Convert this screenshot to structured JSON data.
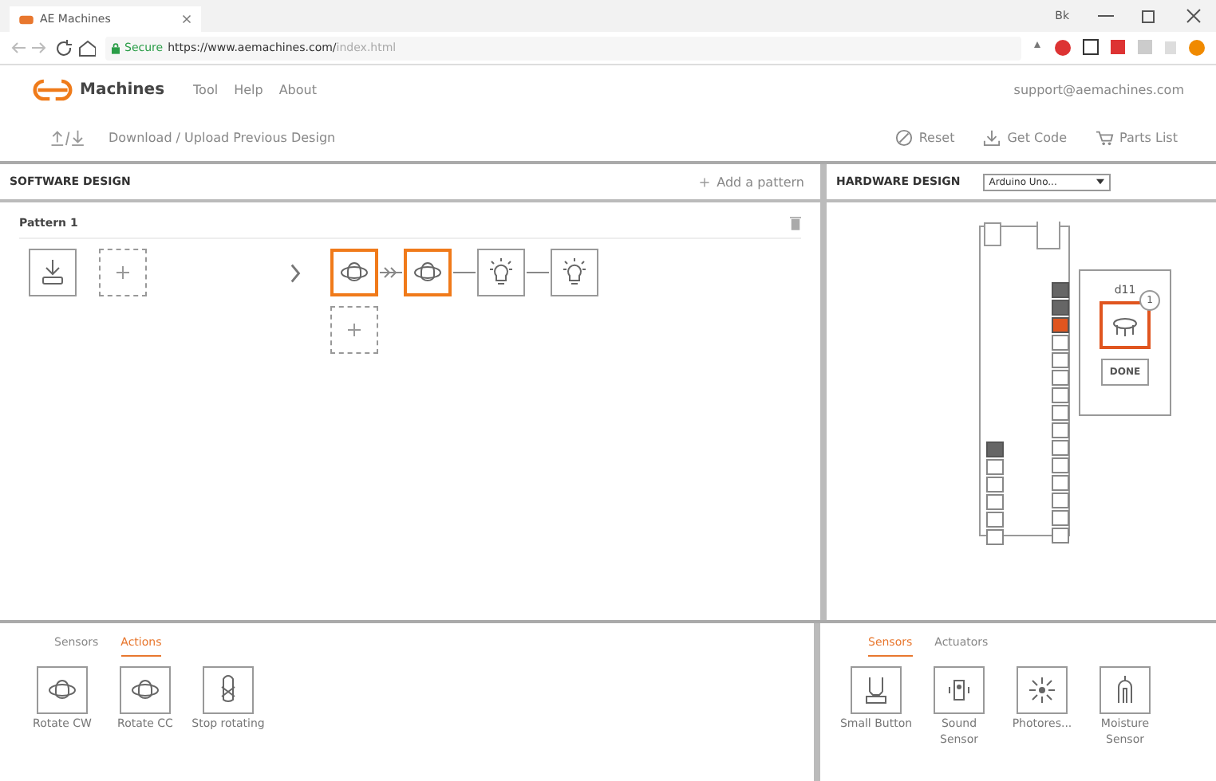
{
  "browser": {
    "tab_title": "AE Machines",
    "profile": "Bk",
    "secure_label": "Secure",
    "url": "https://www.aemachines.com/",
    "url_path": "index.html"
  },
  "header": {
    "brand": "Machines",
    "menu": [
      "Tool",
      "Help",
      "About"
    ],
    "email": "support@aemachines.com"
  },
  "toolbar": {
    "file_label": "Download / Upload Previous Design",
    "actions": [
      {
        "kind": "reset",
        "label": "Reset"
      },
      {
        "kind": "code",
        "label": "Get Code"
      },
      {
        "kind": "cart",
        "label": "Parts List"
      }
    ]
  },
  "software": {
    "title": "SOFTWARE DESIGN",
    "add_label": "Add a pattern",
    "pattern": {
      "title": "Pattern 1",
      "trigger": {
        "kind": "download"
      },
      "chain": [
        {
          "kind": "rotate",
          "selected": true
        },
        {
          "kind": "rotate",
          "selected": true
        },
        {
          "kind": "light",
          "selected": false
        },
        {
          "kind": "light",
          "selected": false
        }
      ]
    }
  },
  "hardware": {
    "title": "HARDWARE DESIGN",
    "board": "Arduino Uno...",
    "pin_label": "d11",
    "badge": "1",
    "done": "DONE",
    "right_pins": [
      {
        "used": true,
        "selected": false
      },
      {
        "used": true,
        "selected": false
      },
      {
        "used": true,
        "selected": true
      },
      {
        "used": false,
        "selected": false
      },
      {
        "used": false,
        "selected": false
      },
      {
        "used": false,
        "selected": false
      },
      {
        "used": false,
        "selected": false
      },
      {
        "used": false,
        "selected": false
      },
      {
        "used": false,
        "selected": false
      },
      {
        "used": false,
        "selected": false
      },
      {
        "used": false,
        "selected": false
      },
      {
        "used": false,
        "selected": false
      },
      {
        "used": false,
        "selected": false
      },
      {
        "used": false,
        "selected": false
      },
      {
        "used": false,
        "selected": false
      }
    ],
    "left_pins": [
      {
        "used": true,
        "selected": false
      },
      {
        "used": false,
        "selected": false
      },
      {
        "used": false,
        "selected": false
      },
      {
        "used": false,
        "selected": false
      },
      {
        "used": false,
        "selected": false
      },
      {
        "used": false,
        "selected": false
      }
    ]
  },
  "library": {
    "tabs": [
      {
        "label": "Sensors",
        "selected": false
      },
      {
        "label": "Actions",
        "selected": true
      }
    ],
    "items": [
      {
        "kind": "rotate",
        "label": "Rotate CW"
      },
      {
        "kind": "rotate",
        "label": "Rotate CC"
      },
      {
        "kind": "stop",
        "label": "Stop rotating"
      }
    ]
  },
  "parts": {
    "tabs": [
      {
        "label": "Sensors",
        "selected": true
      },
      {
        "label": "Actuators",
        "selected": false
      }
    ],
    "items": [
      {
        "kind": "button",
        "label": "Small Button"
      },
      {
        "kind": "sound",
        "label": "Sound Sensor"
      },
      {
        "kind": "photo",
        "label": "Photores..."
      },
      {
        "kind": "moisture",
        "label": "Moisture Sensor"
      }
    ]
  }
}
